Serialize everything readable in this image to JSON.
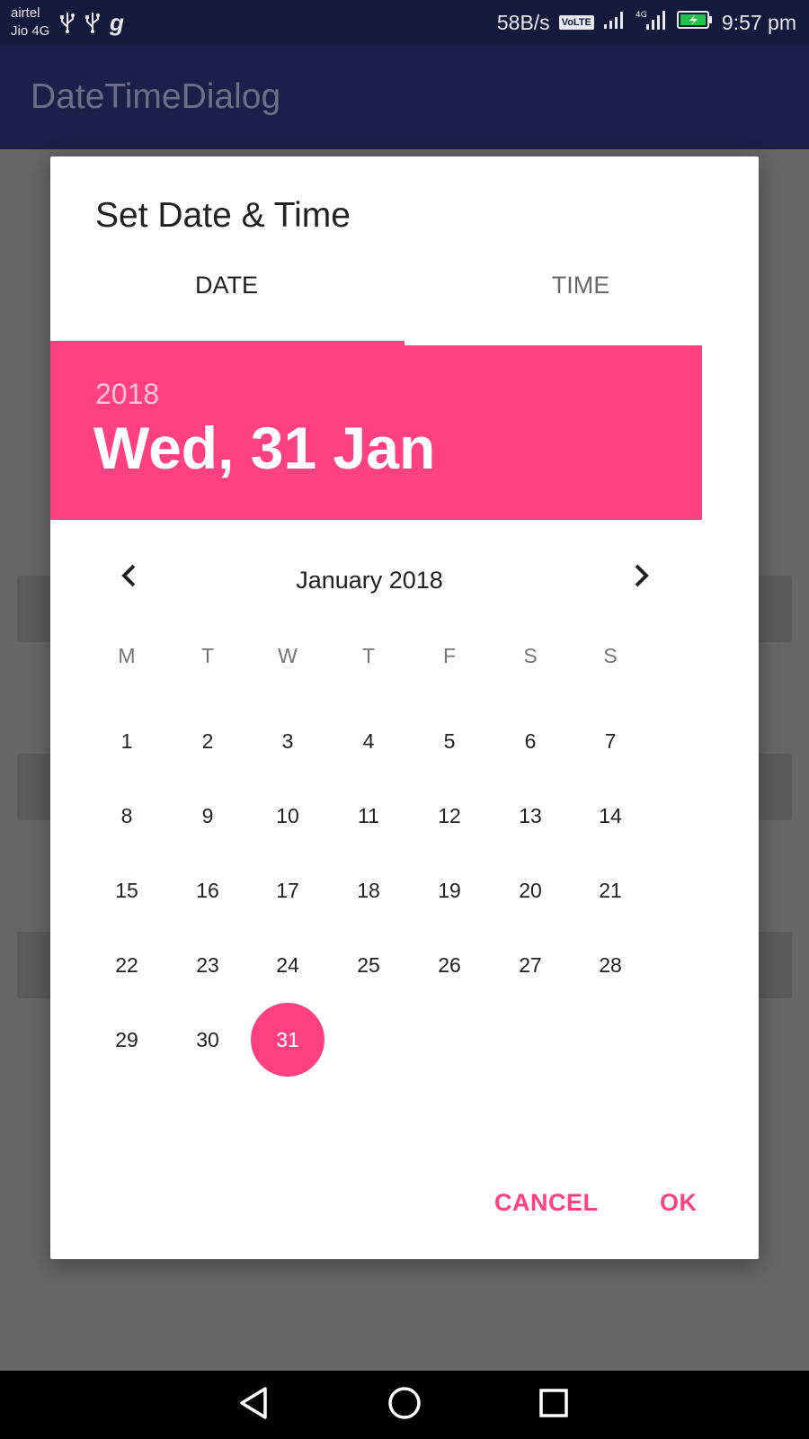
{
  "status_bar": {
    "carrier_1": "airtel",
    "carrier_2": "Jio 4G",
    "left_icons": [
      "usb-icon",
      "usb-icon",
      "g-app-icon"
    ],
    "g_app_glyph": "g",
    "network_speed": "58B/s",
    "volte_badge": "VoLTE",
    "signal_icons": [
      "signal-icon",
      "signal-4g-icon"
    ],
    "battery_icon": "battery-charging-icon",
    "time": "9:57 pm"
  },
  "app_bar": {
    "title": "DateTimeDialog"
  },
  "dialog": {
    "title": "Set Date & Time",
    "tabs": [
      {
        "label": "DATE",
        "selected": true
      },
      {
        "label": "TIME",
        "selected": false
      }
    ],
    "header": {
      "year": "2018",
      "date": "Wed, 31 Jan"
    },
    "calendar": {
      "month_label": "January 2018",
      "prev_icon": "chevron-left-icon",
      "next_icon": "chevron-right-icon",
      "weekdays": [
        "M",
        "T",
        "W",
        "T",
        "F",
        "S",
        "S"
      ],
      "weeks": [
        [
          "1",
          "2",
          "3",
          "4",
          "5",
          "6",
          "7"
        ],
        [
          "8",
          "9",
          "10",
          "11",
          "12",
          "13",
          "14"
        ],
        [
          "15",
          "16",
          "17",
          "18",
          "19",
          "20",
          "21"
        ],
        [
          "22",
          "23",
          "24",
          "25",
          "26",
          "27",
          "28"
        ],
        [
          "29",
          "30",
          "31"
        ]
      ],
      "selected_day": "31"
    },
    "actions": {
      "cancel_label": "CANCEL",
      "ok_label": "OK"
    }
  },
  "nav_bar": {
    "icons": [
      "back-icon",
      "home-icon",
      "recents-icon"
    ]
  },
  "colors": {
    "accent": "#ff4081",
    "status_bar": "#141a3b",
    "app_bar": "#1a2049",
    "scrim": "#666666",
    "year_text": "#ffc4d9"
  }
}
